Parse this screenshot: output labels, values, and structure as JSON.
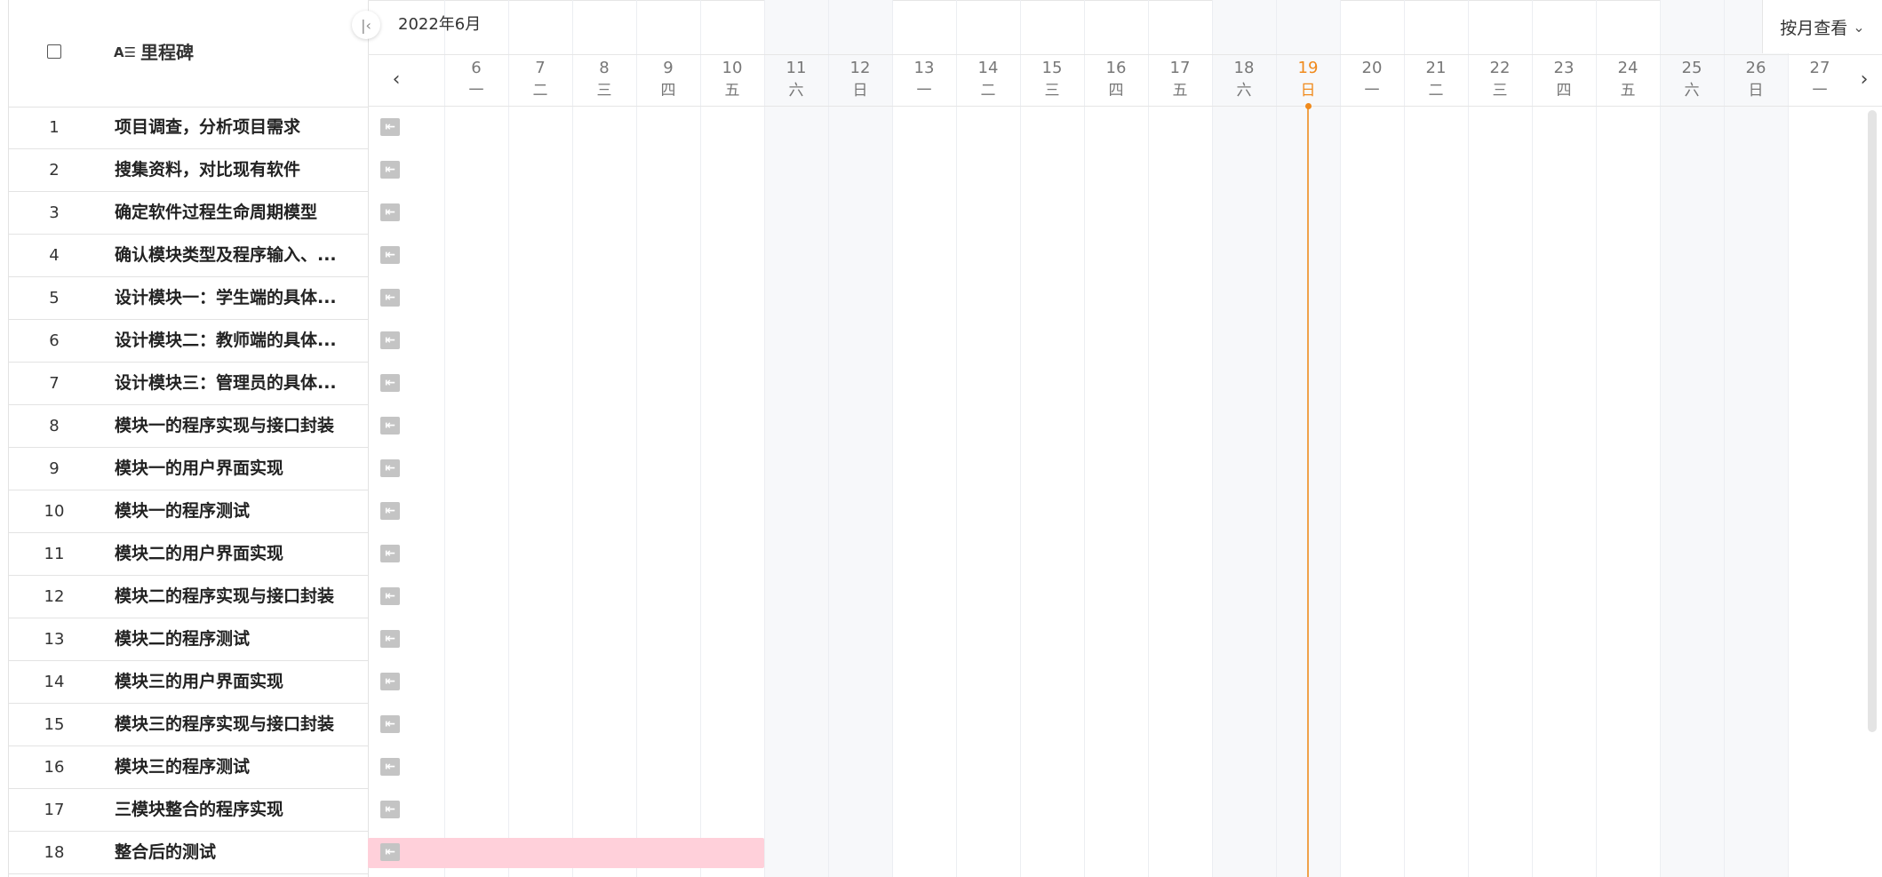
{
  "header": {
    "column_title": "里程碑",
    "column_type_icon": "text-type-icon",
    "month_label": "2022年6月",
    "view_select_label": "按月查看"
  },
  "days": [
    {
      "d": "6",
      "w": "一",
      "weekend": false,
      "today": false
    },
    {
      "d": "7",
      "w": "二",
      "weekend": false,
      "today": false
    },
    {
      "d": "8",
      "w": "三",
      "weekend": false,
      "today": false
    },
    {
      "d": "9",
      "w": "四",
      "weekend": false,
      "today": false
    },
    {
      "d": "10",
      "w": "五",
      "weekend": false,
      "today": false
    },
    {
      "d": "11",
      "w": "六",
      "weekend": true,
      "today": false
    },
    {
      "d": "12",
      "w": "日",
      "weekend": true,
      "today": false
    },
    {
      "d": "13",
      "w": "一",
      "weekend": false,
      "today": false
    },
    {
      "d": "14",
      "w": "二",
      "weekend": false,
      "today": false
    },
    {
      "d": "15",
      "w": "三",
      "weekend": false,
      "today": false
    },
    {
      "d": "16",
      "w": "四",
      "weekend": false,
      "today": false
    },
    {
      "d": "17",
      "w": "五",
      "weekend": false,
      "today": false
    },
    {
      "d": "18",
      "w": "六",
      "weekend": true,
      "today": false
    },
    {
      "d": "19",
      "w": "日",
      "weekend": true,
      "today": true
    },
    {
      "d": "20",
      "w": "一",
      "weekend": false,
      "today": false
    },
    {
      "d": "21",
      "w": "二",
      "weekend": false,
      "today": false
    },
    {
      "d": "22",
      "w": "三",
      "weekend": false,
      "today": false
    },
    {
      "d": "23",
      "w": "四",
      "weekend": false,
      "today": false
    },
    {
      "d": "24",
      "w": "五",
      "weekend": false,
      "today": false
    },
    {
      "d": "25",
      "w": "六",
      "weekend": true,
      "today": false
    },
    {
      "d": "26",
      "w": "日",
      "weekend": true,
      "today": false
    },
    {
      "d": "27",
      "w": "一",
      "weekend": false,
      "today": false
    }
  ],
  "tasks": [
    {
      "num": "1",
      "name": "项目调查，分析项目需求"
    },
    {
      "num": "2",
      "name": "搜集资料，对比现有软件"
    },
    {
      "num": "3",
      "name": "确定软件过程生命周期模型"
    },
    {
      "num": "4",
      "name": "确认模块类型及程序输入、..."
    },
    {
      "num": "5",
      "name": "设计模块一：学生端的具体..."
    },
    {
      "num": "6",
      "name": "设计模块二：教师端的具体..."
    },
    {
      "num": "7",
      "name": "设计模块三：管理员的具体..."
    },
    {
      "num": "8",
      "name": "模块一的程序实现与接口封装"
    },
    {
      "num": "9",
      "name": "模块一的用户界面实现"
    },
    {
      "num": "10",
      "name": "模块一的程序测试"
    },
    {
      "num": "11",
      "name": "模块二的用户界面实现"
    },
    {
      "num": "12",
      "name": "模块二的程序实现与接口封装"
    },
    {
      "num": "13",
      "name": "模块二的程序测试"
    },
    {
      "num": "14",
      "name": "模块三的用户界面实现"
    },
    {
      "num": "15",
      "name": "模块三的程序实现与接口封装"
    },
    {
      "num": "16",
      "name": "模块三的程序测试"
    },
    {
      "num": "17",
      "name": "三模块整合的程序实现"
    },
    {
      "num": "18",
      "name": "整合后的测试",
      "bar_through_day": "10"
    }
  ],
  "colors": {
    "today": "#f08a1c",
    "task_bar": "#ffd0da",
    "weekend_bg": "#f7f8fa"
  }
}
